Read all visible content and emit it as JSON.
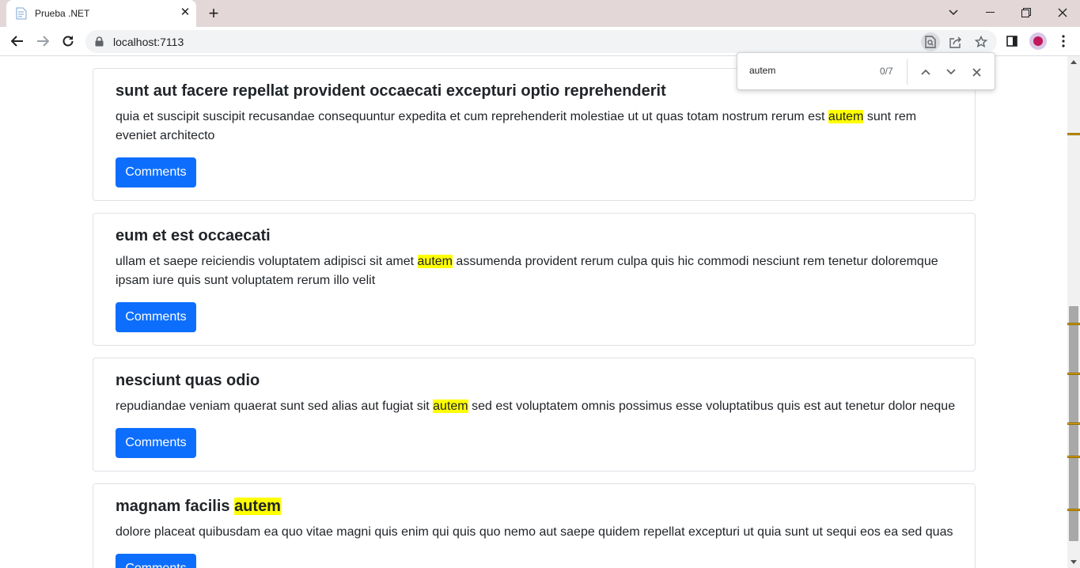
{
  "browser": {
    "tab_title": "Prueba .NET",
    "url": "localhost:7113"
  },
  "find": {
    "query": "autem",
    "count": "0/7"
  },
  "posts": [
    {
      "title": "sunt aut facere repellat provident occaecati excepturi optio reprehenderit",
      "body_before": "quia et suscipit suscipit recusandae consequuntur expedita et cum reprehenderit molestiae ut ut quas totam nostrum rerum est ",
      "body_match": "autem",
      "body_after": " sunt rem eveniet architecto",
      "button": "Comments"
    },
    {
      "title": "eum et est occaecati",
      "body_before": "ullam et saepe reiciendis voluptatem adipisci sit amet ",
      "body_match": "autem",
      "body_after": " assumenda provident rerum culpa quis hic commodi nesciunt rem tenetur doloremque ipsam iure quis sunt voluptatem rerum illo velit",
      "button": "Comments"
    },
    {
      "title": "nesciunt quas odio",
      "body_before": "repudiandae veniam quaerat sunt sed alias aut fugiat sit ",
      "body_match": "autem",
      "body_after": " sed est voluptatem omnis possimus esse voluptatibus quis est aut tenetur dolor neque",
      "button": "Comments"
    },
    {
      "title_before": "magnam facilis ",
      "title_match": "autem",
      "body": "dolore placeat quibusdam ea quo vitae magni quis enim qui quis quo nemo aut saepe quidem repellat excepturi ut quia sunt ut sequi eos ea sed quas",
      "button": "Comments"
    }
  ],
  "colors": {
    "primary_button": "#0d6efd",
    "find_highlight": "#ffff00",
    "scrollbar_match_tick": "#e5a200",
    "tabbar_bg": "#e3d7d7"
  },
  "icons": [
    "page-favicon-icon",
    "close-icon",
    "plus-icon",
    "chevron-down-icon",
    "minimize-icon",
    "restore-icon",
    "arrow-left-icon",
    "arrow-right-icon",
    "reload-icon",
    "lock-icon",
    "find-in-page-icon",
    "share-icon",
    "star-icon",
    "side-panel-icon",
    "avatar",
    "more-vert-icon",
    "chevron-up-icon"
  ]
}
